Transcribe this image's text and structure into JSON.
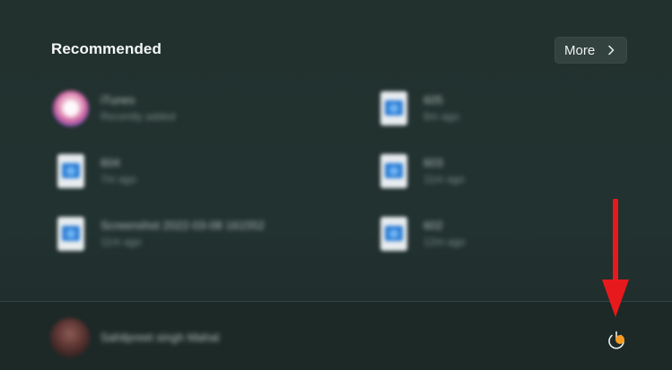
{
  "recommended": {
    "title": "Recommended",
    "more_label": "More",
    "items": [
      {
        "name": "iTunes",
        "subtitle": "Recently added",
        "icon": "itunes-icon"
      },
      {
        "name": "605",
        "subtitle": "6m ago",
        "icon": "image-file-icon"
      },
      {
        "name": "604",
        "subtitle": "7m ago",
        "icon": "image-file-icon"
      },
      {
        "name": "603",
        "subtitle": "11m ago",
        "icon": "image-file-icon"
      },
      {
        "name": "Screenshot 2022-03-08 161552",
        "subtitle": "11m ago",
        "icon": "image-file-icon"
      },
      {
        "name": "602",
        "subtitle": "12m ago",
        "icon": "image-file-icon"
      }
    ]
  },
  "user": {
    "name": "Sahilpreet singh Mahal",
    "avatar": "user-avatar"
  },
  "power": {
    "icon": "power-icon",
    "badge_color": "#f59a23"
  },
  "annotation": {
    "arrow_color": "#e8191c"
  }
}
